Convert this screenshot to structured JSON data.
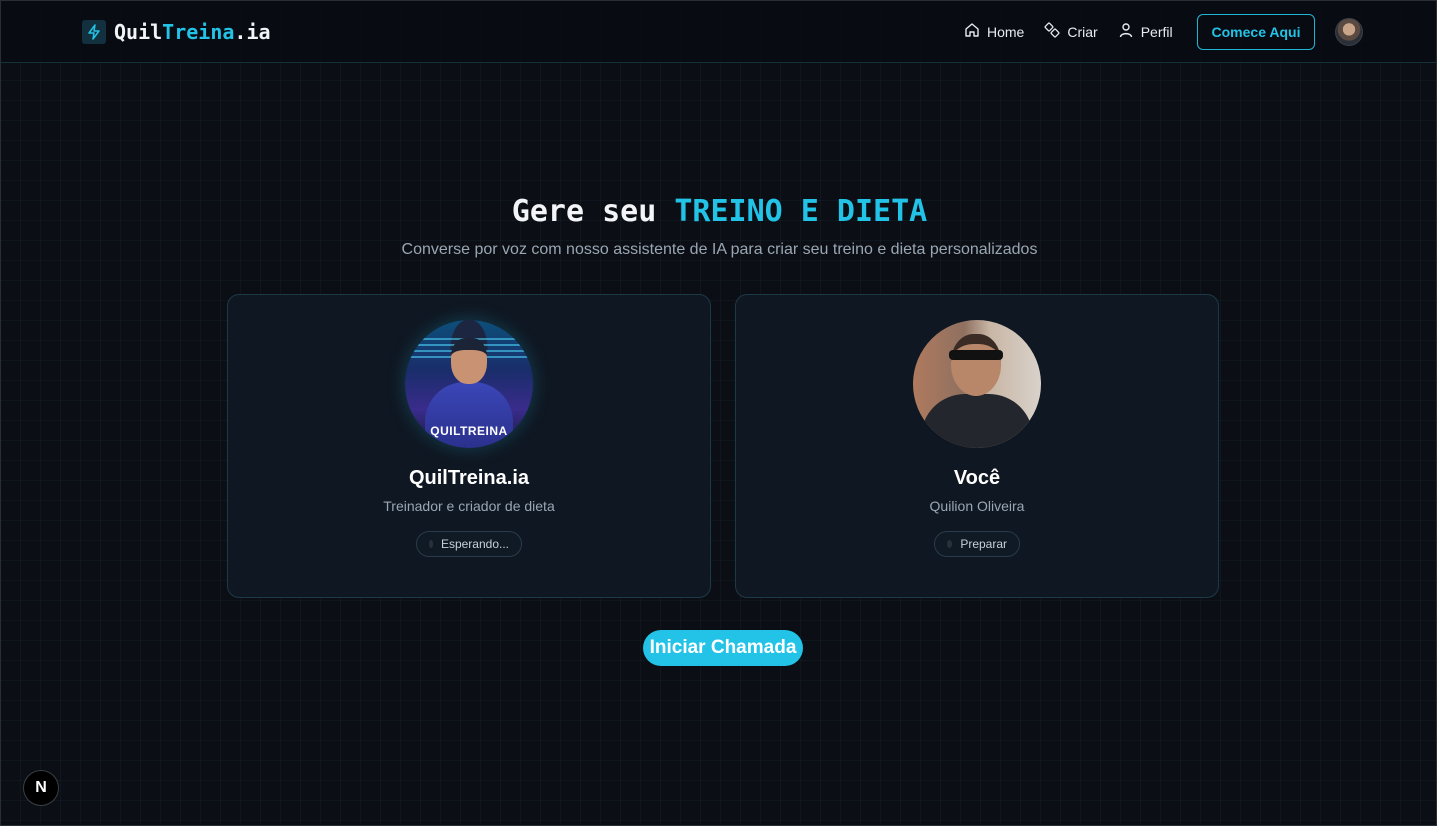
{
  "brand": {
    "part1": "Quil",
    "part2": "Treina",
    "part3": ".ia"
  },
  "nav": {
    "items": [
      {
        "label": "Home",
        "icon": "home-icon"
      },
      {
        "label": "Criar",
        "icon": "create-icon"
      },
      {
        "label": "Perfil",
        "icon": "user-icon"
      }
    ],
    "cta_label": "Comece Aqui"
  },
  "hero": {
    "title_plain": "Gere seu",
    "title_accent": "TREINO E DIETA",
    "subtitle": "Converse por voz com nosso assistente de IA para criar seu treino e dieta personalizados"
  },
  "cards": {
    "ai": {
      "avatar_text": "QUILTREINA",
      "name": "QuilTreina.ia",
      "role": "Treinador e criador de dieta",
      "status": "Esperando..."
    },
    "user": {
      "name": "Você",
      "role": "Quilion Oliveira",
      "status": "Preparar"
    }
  },
  "call_button_label": "Iniciar Chamada",
  "dev_badge": "N",
  "colors": {
    "accent": "#22c3e6",
    "background": "#0b0e14",
    "card": "#0f1722"
  }
}
